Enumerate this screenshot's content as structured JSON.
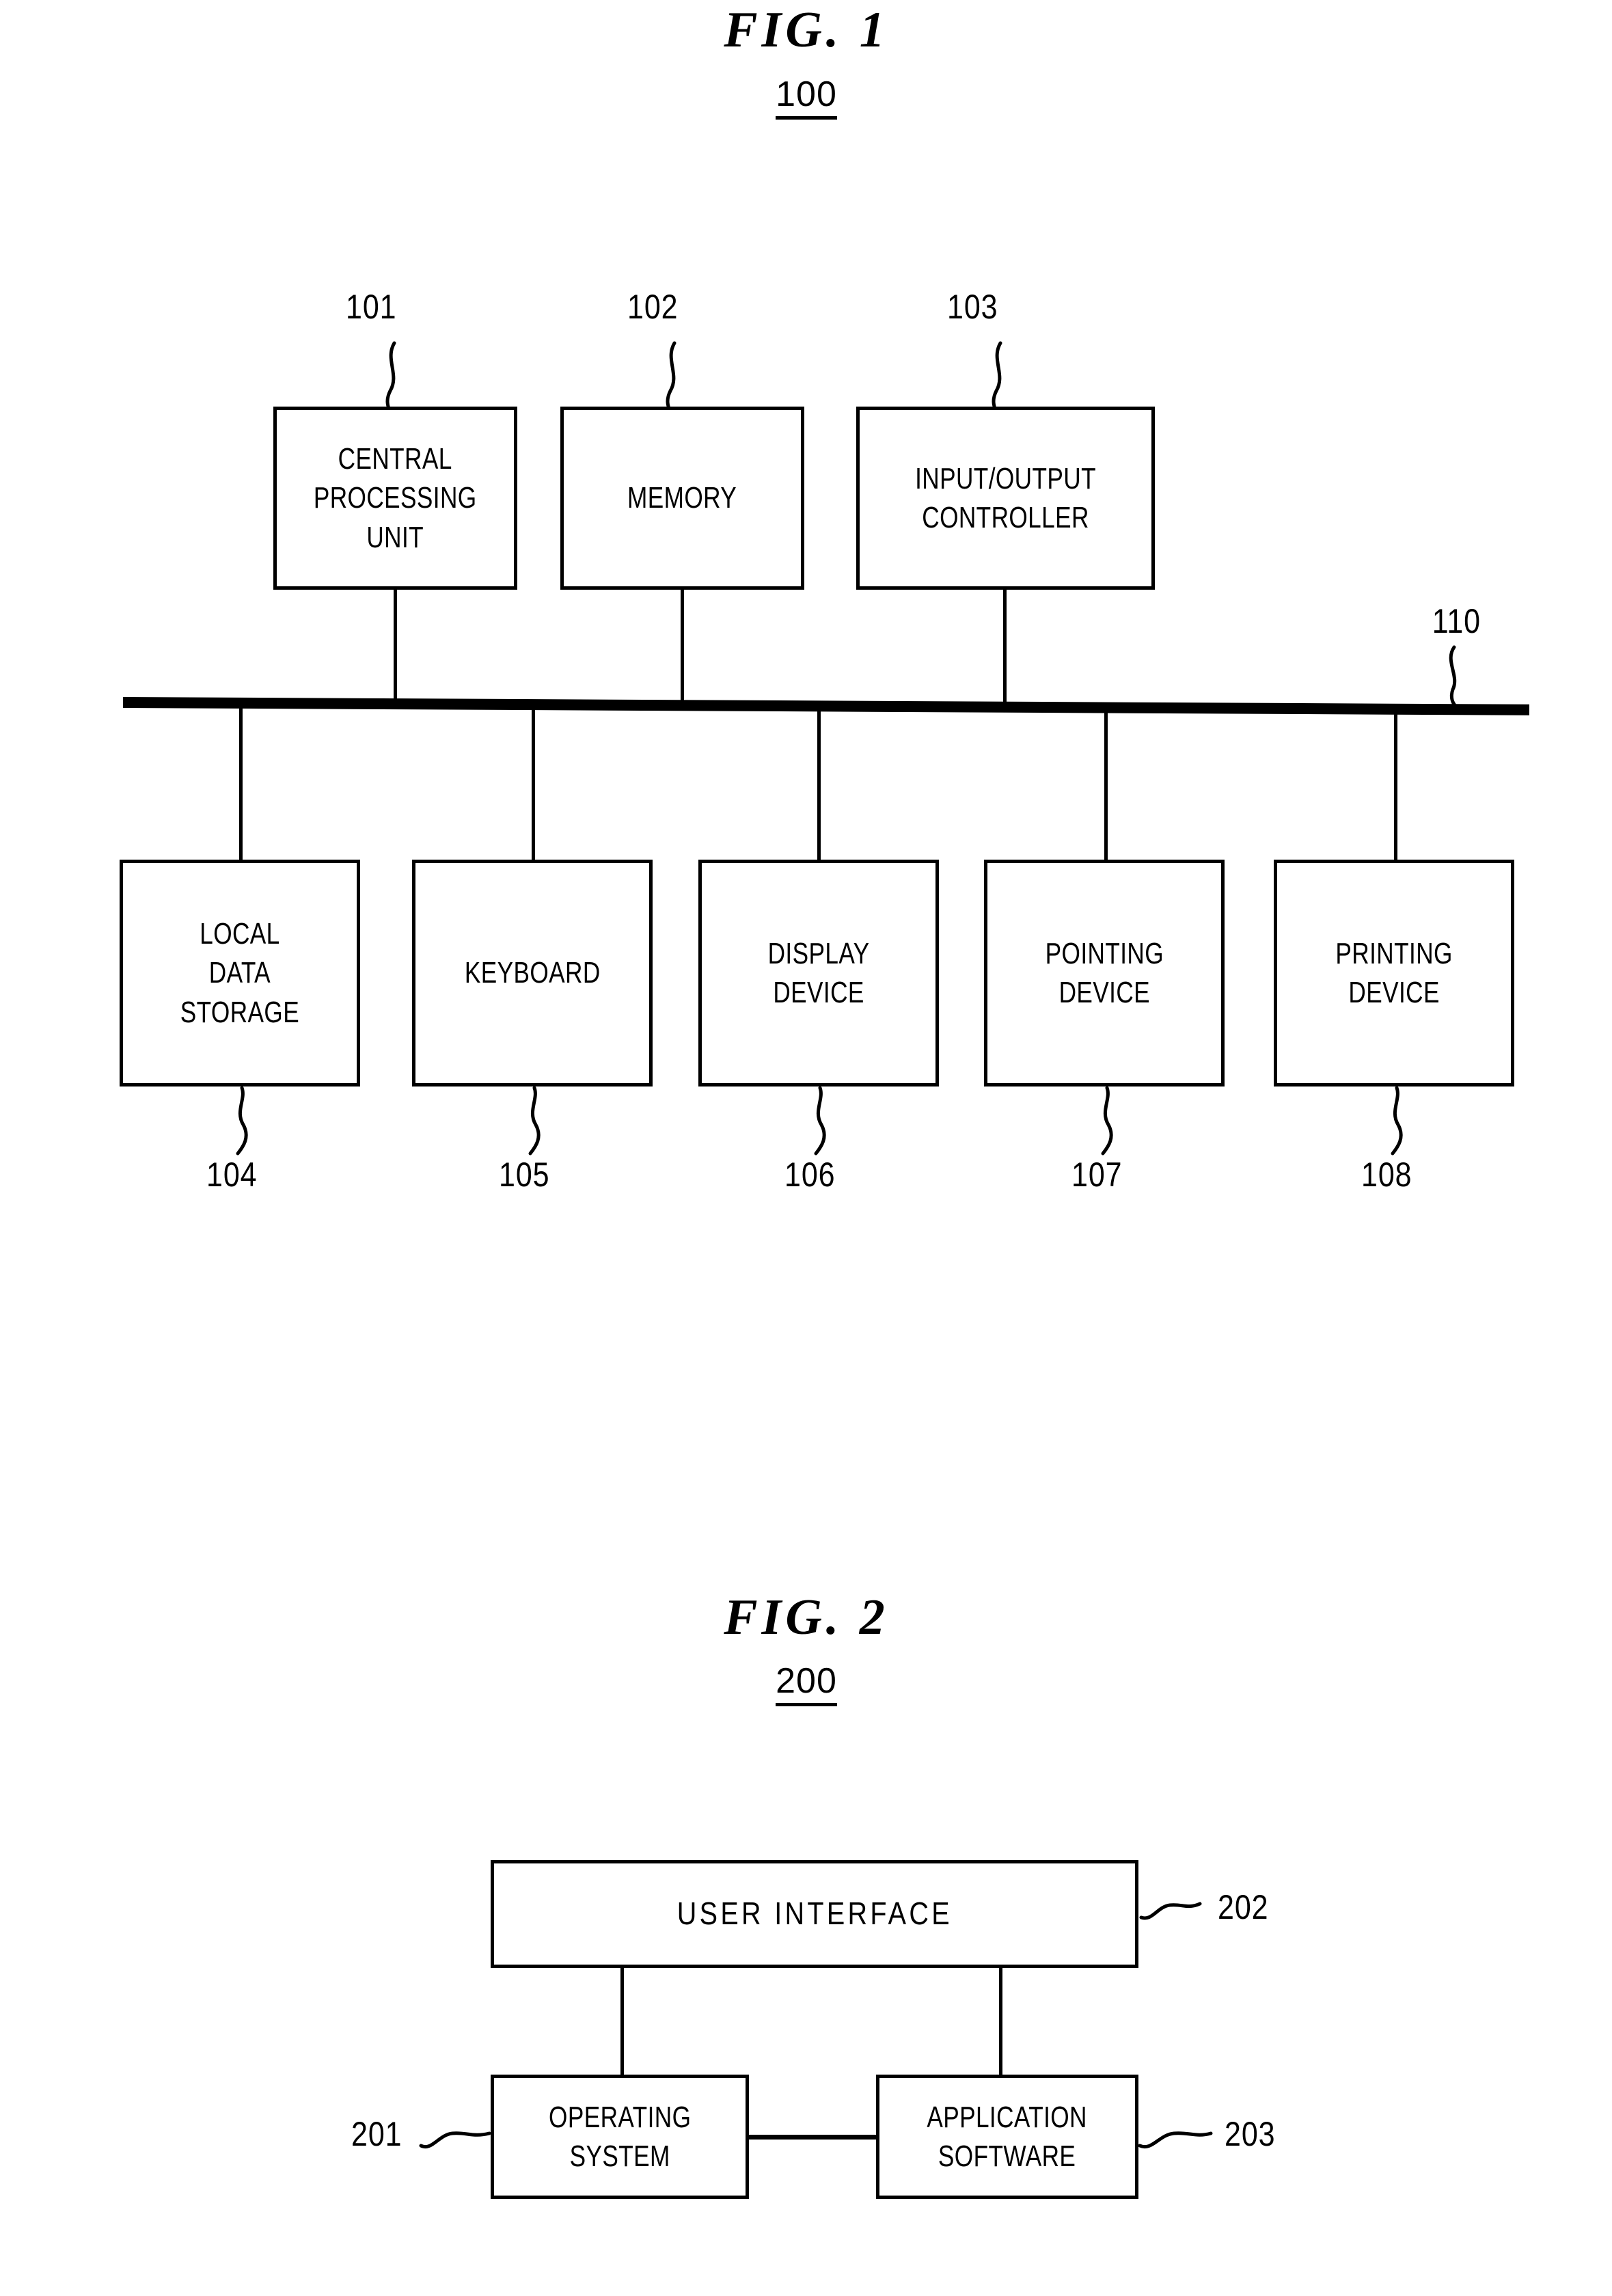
{
  "figures": [
    {
      "title": "FIG.  1",
      "ref": "100",
      "top_nodes": [
        {
          "label": "CENTRAL\nPROCESSING\nUNIT",
          "ref": "101"
        },
        {
          "label": "MEMORY",
          "ref": "102"
        },
        {
          "label": "INPUT/OUTPUT\nCONTROLLER",
          "ref": "103"
        }
      ],
      "bus_ref": "110",
      "bottom_nodes": [
        {
          "label": "LOCAL\nDATA\nSTORAGE",
          "ref": "104"
        },
        {
          "label": "KEYBOARD",
          "ref": "105"
        },
        {
          "label": "DISPLAY\nDEVICE",
          "ref": "106"
        },
        {
          "label": "POINTING\nDEVICE",
          "ref": "107"
        },
        {
          "label": "PRINTING\nDEVICE",
          "ref": "108"
        }
      ]
    },
    {
      "title": "FIG.  2",
      "ref": "200",
      "nodes": [
        {
          "label": "USER INTERFACE",
          "ref": "202"
        },
        {
          "label": "OPERATING\nSYSTEM",
          "ref": "201"
        },
        {
          "label": "APPLICATION\nSOFTWARE",
          "ref": "203"
        }
      ]
    }
  ],
  "colors": {
    "ink": "#000000",
    "paper": "#ffffff"
  }
}
